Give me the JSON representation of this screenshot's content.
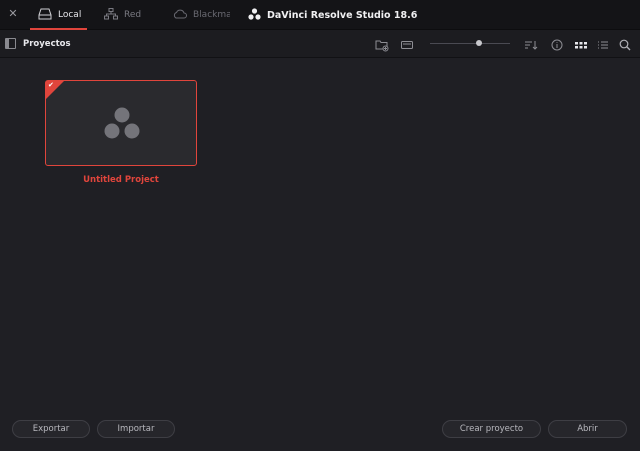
{
  "topbar": {
    "tabs": [
      {
        "label": "Local",
        "icon": "drive-icon",
        "active": true
      },
      {
        "label": "Red",
        "icon": "network-icon",
        "active": false
      },
      {
        "label": "Blackmag",
        "icon": "cloud-icon",
        "active": false
      }
    ],
    "app_title": "DaVinci Resolve Studio 18.6",
    "accent_color": "#e0453c"
  },
  "toolbar": {
    "title": "Proyectos"
  },
  "projects": [
    {
      "name": "Untitled Project",
      "selected": true
    }
  ],
  "footer": {
    "export_label": "Exportar",
    "import_label": "Importar",
    "create_label": "Crear proyecto",
    "open_label": "Abrir"
  }
}
